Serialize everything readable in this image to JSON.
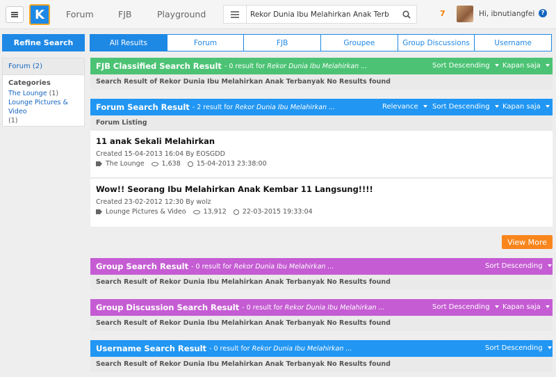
{
  "nav": {
    "forum": "Forum",
    "fjb": "FJB",
    "playground": "Playground"
  },
  "search": {
    "value": "Rekor Dunia Ibu Melahirkan Anak Terbanyak"
  },
  "user": {
    "notifications": "7",
    "name": "Hi, ibnutiangfei",
    "help": "?"
  },
  "sidebar": {
    "refine_label": "Refine Search",
    "forum_label": "Forum (2)",
    "categories_heading": "Categories",
    "categories": [
      {
        "label": "The Lounge",
        "count": "(1)"
      },
      {
        "label": "Lounge Pictures & Video",
        "count": "(1)"
      }
    ]
  },
  "tabs": [
    "All Results",
    "Forum",
    "FJB",
    "Groupee",
    "Group Discussions",
    "Username"
  ],
  "sections": {
    "fjb": {
      "title": "FJB Classified Search Result",
      "count_text": "- 0 result for",
      "query": "Rekor Dunia Ibu Melahirkan ...",
      "sort": "Sort Descending",
      "time": "Kapan saja",
      "empty": "Search Result of Rekor Dunia Ibu Melahirkan Anak Terbanyak No Results found"
    },
    "forum": {
      "title": "Forum Search Result",
      "count_text": "- 2 result for",
      "query": "Rekor Dunia Ibu Melahirkan ...",
      "relevance": "Relevance",
      "sort": "Sort Descending",
      "time": "Kapan saja",
      "listing": "Forum Listing"
    },
    "group": {
      "title": "Group Search Result",
      "count_text": "- 0 result for",
      "query": "Rekor Dunia Ibu Melahirkan ...",
      "sort": "Sort Descending",
      "empty": "Search Result of Rekor Dunia Ibu Melahirkan Anak Terbanyak No Results found"
    },
    "group_discussion": {
      "title": "Group Discussion Search Result",
      "count_text": "- 0 result for",
      "query": "Rekor Dunia Ibu Melahirkan ...",
      "sort": "Sort Descending",
      "time": "Kapan saja",
      "empty": "Search Result of Rekor Dunia Ibu Melahirkan Anak Terbanyak No Results found"
    },
    "username": {
      "title": "Username Search Result",
      "count_text": "- 0 result for",
      "query": "Rekor Dunia Ibu Melahirkan ...",
      "sort": "Sort Descending",
      "empty": "Search Result of Rekor Dunia Ibu Melahirkan Anak Terbanyak No Results found"
    }
  },
  "threads": [
    {
      "title": "11 anak Sekali Melahirkan",
      "created": "Created 15-04-2013 16:04 By EOSGDD",
      "category": "The Lounge",
      "views": "1,638",
      "last": "15-04-2013 23:38:00"
    },
    {
      "title": "Wow!! Seorang Ibu Melahirkan Anak Kembar 11 Langsung!!!!",
      "created": "Created 23-02-2012 12:30 By wolz",
      "category": "Lounge Pictures & Video",
      "views": "13,912",
      "last": "22-03-2015 19:33:04"
    }
  ],
  "view_more": "View More",
  "colors": {
    "primary": "#1e88e5",
    "fjb": "#4cc374",
    "group": "#c55cd3",
    "accent": "#f9861d"
  }
}
